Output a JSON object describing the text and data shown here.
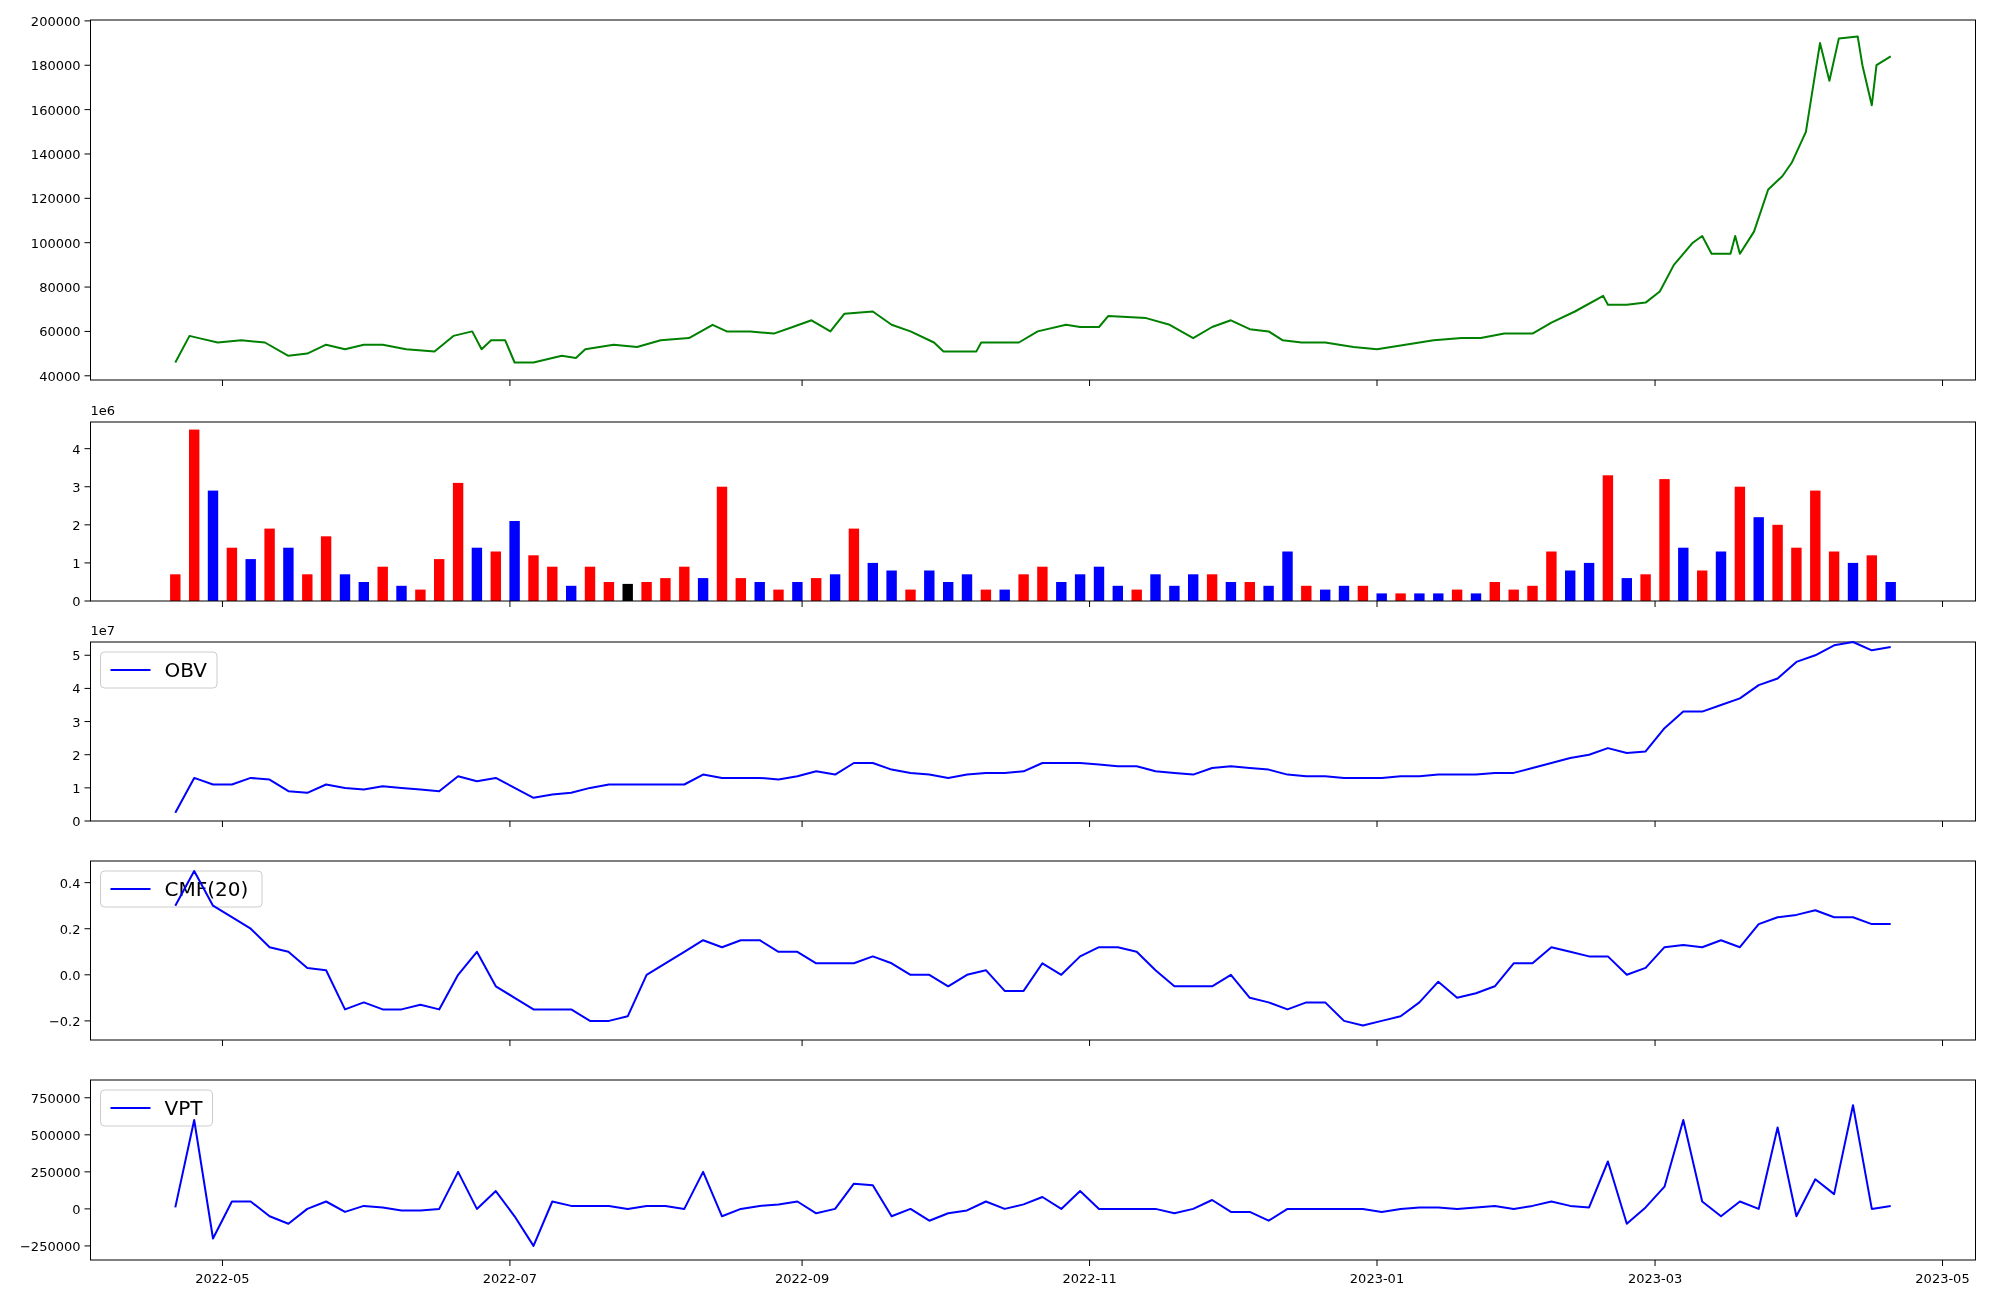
{
  "figure": {
    "panels": [
      {
        "chart_data": {
          "type": "line",
          "x": [
            "2022-04-21",
            "2022-04-24",
            "2022-04-26",
            "2022-04-30",
            "2022-05-05",
            "2022-05-10",
            "2022-05-15",
            "2022-05-19",
            "2022-05-23",
            "2022-05-27",
            "2022-05-31",
            "2022-06-04",
            "2022-06-09",
            "2022-06-15",
            "2022-06-19",
            "2022-06-23",
            "2022-06-25",
            "2022-06-27",
            "2022-06-30",
            "2022-07-02",
            "2022-07-06",
            "2022-07-12",
            "2022-07-15",
            "2022-07-17",
            "2022-07-23",
            "2022-07-28",
            "2022-08-02",
            "2022-08-08",
            "2022-08-13",
            "2022-08-16",
            "2022-08-21",
            "2022-08-26",
            "2022-08-30",
            "2022-09-03",
            "2022-09-07",
            "2022-09-10",
            "2022-09-16",
            "2022-09-20",
            "2022-09-24",
            "2022-09-29",
            "2022-10-01",
            "2022-10-08",
            "2022-10-09",
            "2022-10-17",
            "2022-10-21",
            "2022-10-27",
            "2022-10-30",
            "2022-11-03",
            "2022-11-05",
            "2022-11-13",
            "2022-11-18",
            "2022-11-23",
            "2022-11-27",
            "2022-12-01",
            "2022-12-05",
            "2022-12-09",
            "2022-12-12",
            "2022-12-16",
            "2022-12-21",
            "2022-12-27",
            "2023-01-01",
            "2023-01-07",
            "2023-01-13",
            "2023-01-19",
            "2023-01-23",
            "2023-01-28",
            "2023-02-03",
            "2023-02-07",
            "2023-02-12",
            "2023-02-18",
            "2023-02-19",
            "2023-02-23",
            "2023-02-27",
            "2023-03-02",
            "2023-03-05",
            "2023-03-09",
            "2023-03-11",
            "2023-03-13",
            "2023-03-17",
            "2023-03-18",
            "2023-03-19",
            "2023-03-22",
            "2023-03-25",
            "2023-03-28",
            "2023-03-30",
            "2023-04-02",
            "2023-04-05",
            "2023-04-07",
            "2023-04-09",
            "2023-04-13",
            "2023-04-14",
            "2023-04-16",
            "2023-04-17",
            "2023-04-20"
          ],
          "series": [
            {
              "color": "#008000",
              "values": [
                46000,
                58000,
                57000,
                55000,
                56000,
                55000,
                49000,
                50000,
                54000,
                52000,
                54000,
                54000,
                52000,
                51000,
                58000,
                60000,
                52000,
                56000,
                56000,
                46000,
                46000,
                49000,
                48000,
                52000,
                54000,
                53000,
                56000,
                57000,
                63000,
                60000,
                60000,
                59000,
                62000,
                65000,
                60000,
                68000,
                69000,
                63000,
                60000,
                55000,
                51000,
                51000,
                55000,
                55000,
                60000,
                63000,
                62000,
                62000,
                67000,
                66000,
                63000,
                57000,
                62000,
                65000,
                61000,
                60000,
                56000,
                55000,
                55000,
                53000,
                52000,
                54000,
                56000,
                57000,
                57000,
                59000,
                59000,
                64000,
                69000,
                76000,
                72000,
                72000,
                73000,
                78000,
                90000,
                100000,
                103000,
                95000,
                95000,
                103000,
                95000,
                105000,
                124000,
                130000,
                136000,
                150000,
                190000,
                173000,
                192000,
                193000,
                180000,
                162000,
                180000,
                184000
              ]
            }
          ],
          "xlim": [
            "2022-04-03",
            "2023-05-08"
          ],
          "ylim": [
            38100,
            200400
          ],
          "yticks": [
            {
              "value": 40000,
              "label": "40000"
            },
            {
              "value": 60000,
              "label": "60000"
            },
            {
              "value": 80000,
              "label": "80000"
            },
            {
              "value": 100000,
              "label": "100000"
            },
            {
              "value": 120000,
              "label": "120000"
            },
            {
              "value": 140000,
              "label": "140000"
            },
            {
              "value": 160000,
              "label": "160000"
            },
            {
              "value": 180000,
              "label": "180000"
            },
            {
              "value": 200000,
              "label": "200000"
            }
          ]
        }
      },
      {
        "offset_text": "1e6",
        "chart_data": {
          "type": "bar",
          "x": [
            "2022-04-21",
            "2022-04-25",
            "2022-04-29",
            "2022-05-03",
            "2022-05-07",
            "2022-05-11",
            "2022-05-15",
            "2022-05-19",
            "2022-05-23",
            "2022-05-27",
            "2022-05-31",
            "2022-06-04",
            "2022-06-08",
            "2022-06-12",
            "2022-06-16",
            "2022-06-20",
            "2022-06-24",
            "2022-06-28",
            "2022-07-02",
            "2022-07-06",
            "2022-07-10",
            "2022-07-14",
            "2022-07-18",
            "2022-07-22",
            "2022-07-26",
            "2022-07-30",
            "2022-08-03",
            "2022-08-07",
            "2022-08-11",
            "2022-08-15",
            "2022-08-19",
            "2022-08-23",
            "2022-08-27",
            "2022-08-31",
            "2022-09-04",
            "2022-09-08",
            "2022-09-12",
            "2022-09-16",
            "2022-09-20",
            "2022-09-24",
            "2022-09-28",
            "2022-10-02",
            "2022-10-06",
            "2022-10-10",
            "2022-10-14",
            "2022-10-18",
            "2022-10-22",
            "2022-10-26",
            "2022-10-30",
            "2022-11-03",
            "2022-11-07",
            "2022-11-11",
            "2022-11-15",
            "2022-11-19",
            "2022-11-23",
            "2022-11-27",
            "2022-12-01",
            "2022-12-05",
            "2022-12-09",
            "2022-12-13",
            "2022-12-17",
            "2022-12-21",
            "2022-12-25",
            "2022-12-29",
            "2023-01-02",
            "2023-01-06",
            "2023-01-10",
            "2023-01-14",
            "2023-01-18",
            "2023-01-22",
            "2023-01-26",
            "2023-01-30",
            "2023-02-03",
            "2023-02-07",
            "2023-02-11",
            "2023-02-15",
            "2023-02-19",
            "2023-02-23",
            "2023-02-27",
            "2023-03-03",
            "2023-03-07",
            "2023-03-11",
            "2023-03-15",
            "2023-03-19",
            "2023-03-23",
            "2023-03-27",
            "2023-03-31",
            "2023-04-04",
            "2023-04-08",
            "2023-04-12",
            "2023-04-16",
            "2023-04-20"
          ],
          "values": [
            0.7,
            4.5,
            2.9,
            1.4,
            1.1,
            1.9,
            1.4,
            0.7,
            1.7,
            0.7,
            0.5,
            0.9,
            0.4,
            0.3,
            1.1,
            3.1,
            1.4,
            1.3,
            2.1,
            1.2,
            0.9,
            0.4,
            0.9,
            0.5,
            0.45,
            0.5,
            0.6,
            0.9,
            0.6,
            3.0,
            0.6,
            0.5,
            0.3,
            0.5,
            0.6,
            0.7,
            1.9,
            1.0,
            0.8,
            0.3,
            0.8,
            0.5,
            0.7,
            0.3,
            0.3,
            0.7,
            0.9,
            0.5,
            0.7,
            0.9,
            0.4,
            0.3,
            0.7,
            0.4,
            0.7,
            0.7,
            0.5,
            0.5,
            0.4,
            1.3,
            0.4,
            0.3,
            0.4,
            0.4,
            0.2,
            0.2,
            0.2,
            0.2,
            0.3,
            0.2,
            0.5,
            0.3,
            0.4,
            1.3,
            0.8,
            1.0,
            3.3,
            0.6,
            0.7,
            3.2,
            1.4,
            0.8,
            1.3,
            3.0,
            2.2,
            2.0,
            1.4,
            2.9,
            1.3,
            1.0,
            1.2,
            0.5
          ],
          "colors": [
            "#ff0000",
            "#ff0000",
            "#0000ff",
            "#ff0000",
            "#0000ff",
            "#ff0000",
            "#0000ff",
            "#ff0000",
            "#ff0000",
            "#0000ff",
            "#0000ff",
            "#ff0000",
            "#0000ff",
            "#ff0000",
            "#ff0000",
            "#ff0000",
            "#0000ff",
            "#ff0000",
            "#0000ff",
            "#ff0000",
            "#ff0000",
            "#0000ff",
            "#ff0000",
            "#ff0000",
            "#000000",
            "#ff0000",
            "#ff0000",
            "#ff0000",
            "#0000ff",
            "#ff0000",
            "#ff0000",
            "#0000ff",
            "#ff0000",
            "#0000ff",
            "#ff0000",
            "#0000ff",
            "#ff0000",
            "#0000ff",
            "#0000ff",
            "#ff0000",
            "#0000ff",
            "#0000ff",
            "#0000ff",
            "#ff0000",
            "#0000ff",
            "#ff0000",
            "#ff0000",
            "#0000ff",
            "#0000ff",
            "#0000ff",
            "#0000ff",
            "#ff0000",
            "#0000ff",
            "#0000ff",
            "#0000ff",
            "#ff0000",
            "#0000ff",
            "#ff0000",
            "#0000ff",
            "#0000ff",
            "#ff0000",
            "#0000ff",
            "#0000ff",
            "#ff0000",
            "#0000ff",
            "#ff0000",
            "#0000ff",
            "#0000ff",
            "#ff0000",
            "#0000ff",
            "#ff0000",
            "#ff0000",
            "#ff0000",
            "#ff0000",
            "#0000ff",
            "#0000ff",
            "#ff0000",
            "#0000ff",
            "#ff0000",
            "#ff0000",
            "#0000ff",
            "#ff0000",
            "#0000ff",
            "#ff0000",
            "#0000ff",
            "#ff0000",
            "#ff0000",
            "#ff0000",
            "#ff0000",
            "#0000ff",
            "#ff0000",
            "#0000ff"
          ],
          "xlim": [
            "2022-04-03",
            "2023-05-08"
          ],
          "ylim": [
            0,
            4.7
          ],
          "yticks": [
            {
              "value": 0,
              "label": "0"
            },
            {
              "value": 1,
              "label": "1"
            },
            {
              "value": 2,
              "label": "2"
            },
            {
              "value": 3,
              "label": "3"
            },
            {
              "value": 4,
              "label": "4"
            }
          ]
        }
      },
      {
        "offset_text": "1e7",
        "chart_data": {
          "type": "line",
          "x": [
            "2022-04-21",
            "2022-04-25",
            "2022-04-29",
            "2022-05-03",
            "2022-05-07",
            "2022-05-11",
            "2022-05-15",
            "2022-05-19",
            "2022-05-23",
            "2022-05-27",
            "2022-05-31",
            "2022-06-04",
            "2022-06-08",
            "2022-06-12",
            "2022-06-16",
            "2022-06-20",
            "2022-06-24",
            "2022-06-28",
            "2022-07-02",
            "2022-07-06",
            "2022-07-10",
            "2022-07-14",
            "2022-07-18",
            "2022-07-22",
            "2022-07-26",
            "2022-07-30",
            "2022-08-03",
            "2022-08-07",
            "2022-08-11",
            "2022-08-15",
            "2022-08-19",
            "2022-08-23",
            "2022-08-27",
            "2022-08-31",
            "2022-09-04",
            "2022-09-08",
            "2022-09-12",
            "2022-09-16",
            "2022-09-20",
            "2022-09-24",
            "2022-09-28",
            "2022-10-02",
            "2022-10-06",
            "2022-10-10",
            "2022-10-14",
            "2022-10-18",
            "2022-10-22",
            "2022-10-26",
            "2022-10-30",
            "2022-11-03",
            "2022-11-07",
            "2022-11-11",
            "2022-11-15",
            "2022-11-19",
            "2022-11-23",
            "2022-11-27",
            "2022-12-01",
            "2022-12-05",
            "2022-12-09",
            "2022-12-13",
            "2022-12-17",
            "2022-12-21",
            "2022-12-25",
            "2022-12-29",
            "2023-01-02",
            "2023-01-06",
            "2023-01-10",
            "2023-01-14",
            "2023-01-18",
            "2023-01-22",
            "2023-01-26",
            "2023-01-30",
            "2023-02-03",
            "2023-02-07",
            "2023-02-11",
            "2023-02-15",
            "2023-02-19",
            "2023-02-23",
            "2023-02-27",
            "2023-03-03",
            "2023-03-07",
            "2023-03-11",
            "2023-03-15",
            "2023-03-19",
            "2023-03-23",
            "2023-03-27",
            "2023-03-31",
            "2023-04-04",
            "2023-04-08",
            "2023-04-12",
            "2023-04-16",
            "2023-04-20"
          ],
          "series": [
            {
              "name": "OBV",
              "color": "#0000ff",
              "values": [
                0.25,
                1.3,
                1.1,
                1.1,
                1.3,
                1.25,
                0.9,
                0.85,
                1.1,
                1.0,
                0.95,
                1.05,
                1.0,
                0.95,
                0.9,
                1.35,
                1.2,
                1.3,
                1.0,
                0.7,
                0.8,
                0.85,
                1.0,
                1.1,
                1.1,
                1.1,
                1.1,
                1.1,
                1.4,
                1.3,
                1.3,
                1.3,
                1.25,
                1.35,
                1.5,
                1.4,
                1.75,
                1.75,
                1.55,
                1.45,
                1.4,
                1.3,
                1.4,
                1.45,
                1.45,
                1.5,
                1.75,
                1.75,
                1.75,
                1.7,
                1.65,
                1.65,
                1.5,
                1.45,
                1.4,
                1.6,
                1.65,
                1.6,
                1.55,
                1.4,
                1.35,
                1.35,
                1.3,
                1.3,
                1.3,
                1.35,
                1.35,
                1.4,
                1.4,
                1.4,
                1.45,
                1.45,
                1.6,
                1.75,
                1.9,
                2.0,
                2.2,
                2.05,
                2.1,
                2.8,
                3.3,
                3.3,
                3.5,
                3.7,
                4.1,
                4.3,
                4.8,
                5.0,
                5.3,
                5.4,
                5.15,
                5.25
              ]
            }
          ],
          "xlim": [
            "2022-04-03",
            "2023-05-08"
          ],
          "ylim": [
            0,
            5.4
          ],
          "yticks": [
            {
              "value": 0,
              "label": "0"
            },
            {
              "value": 1,
              "label": "1"
            },
            {
              "value": 2,
              "label": "2"
            },
            {
              "value": 3,
              "label": "3"
            },
            {
              "value": 4,
              "label": "4"
            },
            {
              "value": 5,
              "label": "5"
            }
          ]
        }
      },
      {
        "chart_data": {
          "type": "line",
          "x": [
            "2022-04-21",
            "2022-04-25",
            "2022-04-29",
            "2022-05-03",
            "2022-05-07",
            "2022-05-11",
            "2022-05-15",
            "2022-05-19",
            "2022-05-23",
            "2022-05-27",
            "2022-05-31",
            "2022-06-04",
            "2022-06-08",
            "2022-06-12",
            "2022-06-16",
            "2022-06-20",
            "2022-06-24",
            "2022-06-28",
            "2022-07-02",
            "2022-07-06",
            "2022-07-10",
            "2022-07-14",
            "2022-07-18",
            "2022-07-22",
            "2022-07-26",
            "2022-07-30",
            "2022-08-03",
            "2022-08-07",
            "2022-08-11",
            "2022-08-15",
            "2022-08-19",
            "2022-08-23",
            "2022-08-27",
            "2022-08-31",
            "2022-09-04",
            "2022-09-08",
            "2022-09-12",
            "2022-09-16",
            "2022-09-20",
            "2022-09-24",
            "2022-09-28",
            "2022-10-02",
            "2022-10-06",
            "2022-10-10",
            "2022-10-14",
            "2022-10-18",
            "2022-10-22",
            "2022-10-26",
            "2022-10-30",
            "2022-11-03",
            "2022-11-07",
            "2022-11-11",
            "2022-11-15",
            "2022-11-19",
            "2022-11-23",
            "2022-11-27",
            "2022-12-01",
            "2022-12-05",
            "2022-12-09",
            "2022-12-13",
            "2022-12-17",
            "2022-12-21",
            "2022-12-25",
            "2022-12-29",
            "2023-01-02",
            "2023-01-06",
            "2023-01-10",
            "2023-01-14",
            "2023-01-18",
            "2023-01-22",
            "2023-01-26",
            "2023-01-30",
            "2023-02-03",
            "2023-02-07",
            "2023-02-11",
            "2023-02-15",
            "2023-02-19",
            "2023-02-23",
            "2023-02-27",
            "2023-03-03",
            "2023-03-07",
            "2023-03-11",
            "2023-03-15",
            "2023-03-19",
            "2023-03-23",
            "2023-03-27",
            "2023-03-31",
            "2023-04-04",
            "2023-04-08",
            "2023-04-12",
            "2023-04-16",
            "2023-04-20"
          ],
          "series": [
            {
              "name": "CMF(20)",
              "color": "#0000ff",
              "values": [
                0.3,
                0.45,
                0.3,
                0.25,
                0.2,
                0.12,
                0.1,
                0.03,
                0.02,
                -0.15,
                -0.12,
                -0.15,
                -0.15,
                -0.13,
                -0.15,
                0.0,
                0.1,
                -0.05,
                -0.1,
                -0.15,
                -0.15,
                -0.15,
                -0.2,
                -0.2,
                -0.18,
                0.0,
                0.05,
                0.1,
                0.15,
                0.12,
                0.15,
                0.15,
                0.1,
                0.1,
                0.05,
                0.05,
                0.05,
                0.08,
                0.05,
                0.0,
                0.0,
                -0.05,
                0.0,
                0.02,
                -0.07,
                -0.07,
                0.05,
                0.0,
                0.08,
                0.12,
                0.12,
                0.1,
                0.02,
                -0.05,
                -0.05,
                -0.05,
                0.0,
                -0.1,
                -0.12,
                -0.15,
                -0.12,
                -0.12,
                -0.2,
                -0.22,
                -0.2,
                -0.18,
                -0.12,
                -0.03,
                -0.1,
                -0.08,
                -0.05,
                0.05,
                0.05,
                0.12,
                0.1,
                0.08,
                0.08,
                0.0,
                0.03,
                0.12,
                0.13,
                0.12,
                0.15,
                0.12,
                0.22,
                0.25,
                0.26,
                0.28,
                0.25,
                0.25,
                0.22,
                0.22
              ]
            }
          ],
          "xlim": [
            "2022-04-03",
            "2023-05-08"
          ],
          "ylim": [
            -0.283,
            0.494
          ],
          "yticks": [
            {
              "value": -0.2,
              "label": "−0.2"
            },
            {
              "value": 0,
              "label": "0.0"
            },
            {
              "value": 0.2,
              "label": "0.2"
            },
            {
              "value": 0.4,
              "label": "0.4"
            }
          ]
        }
      },
      {
        "chart_data": {
          "type": "line",
          "x": [
            "2022-04-21",
            "2022-04-25",
            "2022-04-29",
            "2022-05-03",
            "2022-05-07",
            "2022-05-11",
            "2022-05-15",
            "2022-05-19",
            "2022-05-23",
            "2022-05-27",
            "2022-05-31",
            "2022-06-04",
            "2022-06-08",
            "2022-06-12",
            "2022-06-16",
            "2022-06-20",
            "2022-06-24",
            "2022-06-28",
            "2022-07-02",
            "2022-07-06",
            "2022-07-10",
            "2022-07-14",
            "2022-07-18",
            "2022-07-22",
            "2022-07-26",
            "2022-07-30",
            "2022-08-03",
            "2022-08-07",
            "2022-08-11",
            "2022-08-15",
            "2022-08-19",
            "2022-08-23",
            "2022-08-27",
            "2022-08-31",
            "2022-09-04",
            "2022-09-08",
            "2022-09-12",
            "2022-09-16",
            "2022-09-20",
            "2022-09-24",
            "2022-09-28",
            "2022-10-02",
            "2022-10-06",
            "2022-10-10",
            "2022-10-14",
            "2022-10-18",
            "2022-10-22",
            "2022-10-26",
            "2022-10-30",
            "2022-11-03",
            "2022-11-07",
            "2022-11-11",
            "2022-11-15",
            "2022-11-19",
            "2022-11-23",
            "2022-11-27",
            "2022-12-01",
            "2022-12-05",
            "2022-12-09",
            "2022-12-13",
            "2022-12-17",
            "2022-12-21",
            "2022-12-25",
            "2022-12-29",
            "2023-01-02",
            "2023-01-06",
            "2023-01-10",
            "2023-01-14",
            "2023-01-18",
            "2023-01-22",
            "2023-01-26",
            "2023-01-30",
            "2023-02-03",
            "2023-02-07",
            "2023-02-11",
            "2023-02-15",
            "2023-02-19",
            "2023-02-23",
            "2023-02-27",
            "2023-03-03",
            "2023-03-07",
            "2023-03-11",
            "2023-03-15",
            "2023-03-19",
            "2023-03-23",
            "2023-03-27",
            "2023-03-31",
            "2023-04-04",
            "2023-04-08",
            "2023-04-12",
            "2023-04-16",
            "2023-04-20"
          ],
          "series": [
            {
              "name": "VPT",
              "color": "#0000ff",
              "values": [
                10000,
                600000,
                -200000,
                50000,
                50000,
                -50000,
                -100000,
                0,
                50000,
                -20000,
                20000,
                10000,
                -10000,
                -10000,
                0,
                250000,
                0,
                120000,
                -50000,
                -250000,
                50000,
                20000,
                20000,
                20000,
                0,
                20000,
                20000,
                0,
                250000,
                -50000,
                0,
                20000,
                30000,
                50000,
                -30000,
                0,
                170000,
                160000,
                -50000,
                0,
                -80000,
                -30000,
                -10000,
                50000,
                0,
                30000,
                80000,
                0,
                120000,
                0,
                0,
                0,
                0,
                -30000,
                0,
                60000,
                -20000,
                -20000,
                -80000,
                0,
                0,
                0,
                0,
                0,
                -20000,
                0,
                10000,
                10000,
                0,
                10000,
                20000,
                0,
                20000,
                50000,
                20000,
                10000,
                320000,
                -100000,
                10000,
                150000,
                600000,
                50000,
                -50000,
                50000,
                0,
                550000,
                -50000,
                200000,
                100000,
                700000,
                0,
                20000
              ]
            }
          ],
          "xlim": [
            "2022-04-03",
            "2023-05-08"
          ],
          "ylim": [
            -345000,
            870000
          ],
          "yticks": [
            {
              "value": -250000,
              "label": "−250000"
            },
            {
              "value": 0,
              "label": "0"
            },
            {
              "value": 250000,
              "label": "250000"
            },
            {
              "value": 500000,
              "label": "500000"
            },
            {
              "value": 750000,
              "label": "750000"
            }
          ],
          "xticks": [
            {
              "value": "2022-05-01",
              "label": "2022-05"
            },
            {
              "value": "2022-07-01",
              "label": "2022-07"
            },
            {
              "value": "2022-09-01",
              "label": "2022-09"
            },
            {
              "value": "2022-11-01",
              "label": "2022-11"
            },
            {
              "value": "2023-01-01",
              "label": "2023-01"
            },
            {
              "value": "2023-03-01",
              "label": "2023-03"
            },
            {
              "value": "2023-05-01",
              "label": "2023-05"
            }
          ]
        }
      }
    ]
  }
}
